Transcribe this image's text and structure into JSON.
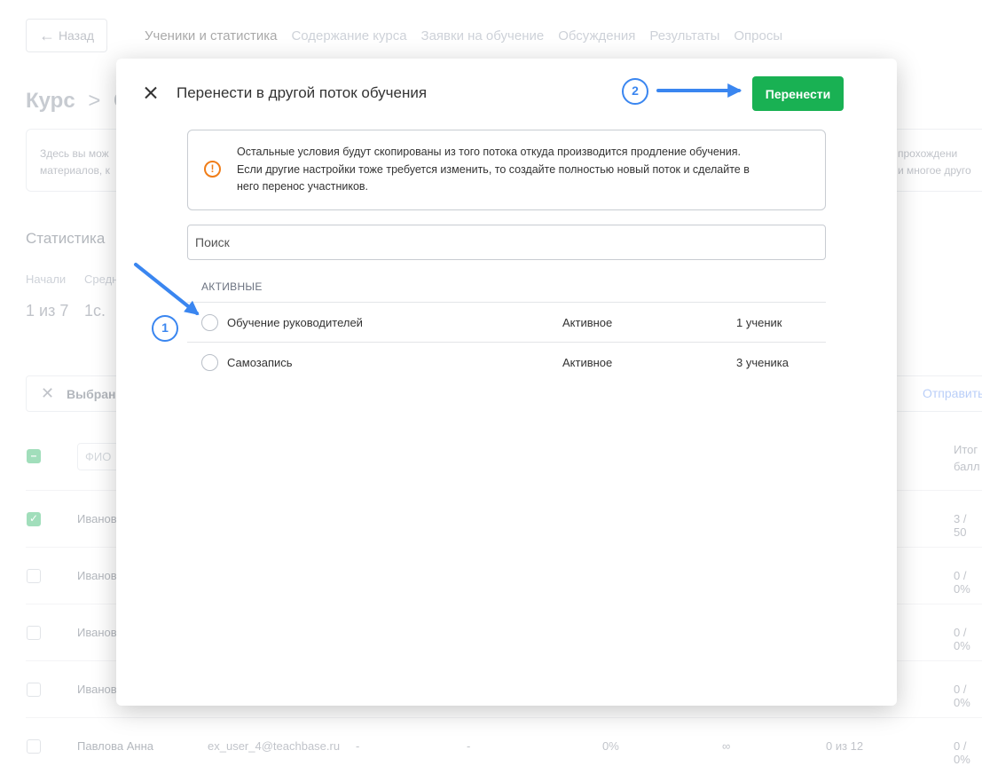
{
  "background": {
    "back_label": "Назад",
    "tabs": [
      "Ученики и статистика",
      "Содержание курса",
      "Заявки на обучение",
      "Обсуждения",
      "Результаты",
      "Опросы"
    ],
    "breadcrumb_course": "Курс",
    "breadcrumb_sep": ">",
    "breadcrumb_next": "С",
    "info_left_line1": "Здесь вы мож",
    "info_left_line2": "материалов, к",
    "info_right_line1": "прохождени",
    "info_right_line2": "и многое друго",
    "stats_title": "Статистика",
    "stat_label_1": "Начали",
    "stat_label_2": "Средн",
    "stat_value_1": "1 из 7",
    "stat_value_2": "1с.",
    "selected_label": "Выбрано",
    "send_label": "Отправить",
    "fio_placeholder": "ФИО",
    "score_header_line1": "Итог",
    "score_header_line2": "балл",
    "rows": [
      {
        "name": "Иванов",
        "score": "3 / 50"
      },
      {
        "name": "Иванов",
        "score": "0 / 0%"
      },
      {
        "name": "Иванов",
        "score": "0 / 0%"
      },
      {
        "name": "Иванов",
        "score": "0 / 0%"
      }
    ],
    "last_row": {
      "name": "Павлова Анна",
      "email": "ex_user_4@teachbase.ru",
      "dash1": "-",
      "dash2": "-",
      "progress": "0%",
      "infinity": "∞",
      "count": "0 из 12",
      "score": "0 / 0%"
    }
  },
  "modal": {
    "title": "Перенести в другой поток обучения",
    "submit_label": "Перенести",
    "alert_icon": "!",
    "alert_text": "Остальные условия будут скопированы из того потока откуда производится продление обучения. Если другие настройки тоже требуется изменить, то создайте полностью новый поток и сделайте в него перенос участников.",
    "search_placeholder": "Поиск",
    "section_label": "АКТИВНЫЕ",
    "options": [
      {
        "name": "Обучение руководителей",
        "status": "Активное",
        "count": "1 ученик"
      },
      {
        "name": "Самозапись",
        "status": "Активное",
        "count": "3 ученика"
      }
    ]
  },
  "annotations": {
    "badge_1": "1",
    "badge_2": "2",
    "color": "#3a86f0"
  },
  "colors": {
    "accent_green": "#19b153",
    "warning_orange": "#f07d18"
  }
}
